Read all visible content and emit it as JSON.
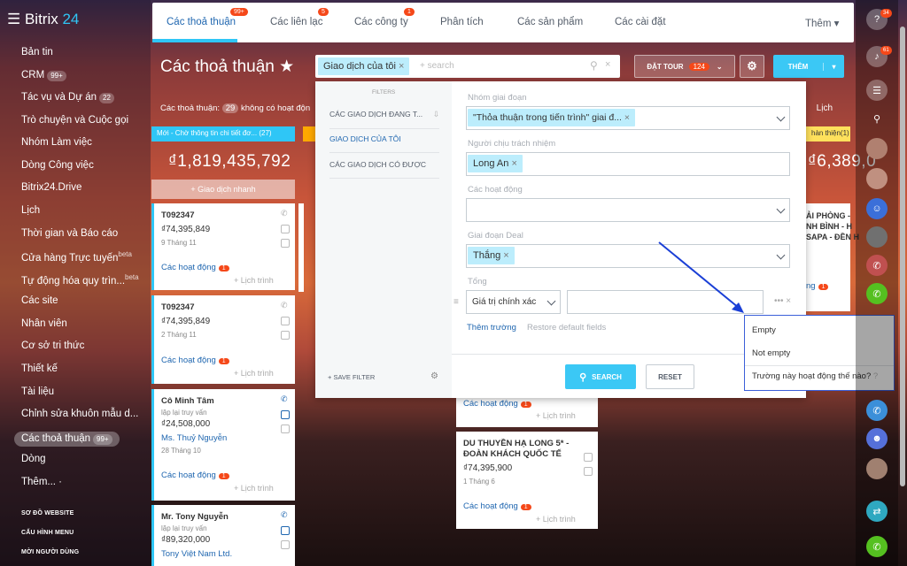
{
  "app": {
    "logo_a": "Bitrix",
    "logo_b": " 24"
  },
  "menu": [
    {
      "label": "Bản tin",
      "count": ""
    },
    {
      "label": "CRM",
      "count": "99+"
    },
    {
      "label": "Tác vụ và Dự án",
      "count": "22"
    },
    {
      "label": "Trò chuyện và Cuộc gọi",
      "count": ""
    },
    {
      "label": "Nhóm Làm việc",
      "count": ""
    },
    {
      "label": "Dòng Công việc",
      "count": ""
    },
    {
      "label": "Bitrix24.Drive",
      "count": ""
    },
    {
      "label": "Lịch",
      "count": ""
    },
    {
      "label": "Thời gian và Báo cáo",
      "count": ""
    },
    {
      "label": "Cửa hàng Trực tuyến",
      "count": "beta"
    },
    {
      "label": "Tự động hóa quy trìn...",
      "count": "beta"
    },
    {
      "label": "Các site",
      "count": ""
    },
    {
      "label": "Nhân viên",
      "count": ""
    },
    {
      "label": "Cơ sở tri thức",
      "count": ""
    },
    {
      "label": "Thiết kế",
      "count": ""
    },
    {
      "label": "Tài liệu",
      "count": ""
    },
    {
      "label": "Chỉnh sửa khuôn mẫu d...",
      "count": ""
    },
    {
      "label": "Các thoả thuận",
      "count": "99+"
    },
    {
      "label": "Dòng",
      "count": ""
    },
    {
      "label": "Thêm... ·",
      "count": ""
    }
  ],
  "menu_footer": [
    "SƠ ĐỒ WEBSITE",
    "CẤU HÌNH MENU",
    "MỜI NGƯỜI DÙNG"
  ],
  "tabs": [
    {
      "label": "Các thoả thuận",
      "badge": "99+"
    },
    {
      "label": "Các liên lạc",
      "badge": "5"
    },
    {
      "label": "Các công ty",
      "badge": "1"
    },
    {
      "label": "Phân tích",
      "badge": ""
    },
    {
      "label": "Các sản phẩm",
      "badge": ""
    },
    {
      "label": "Các cài đặt",
      "badge": ""
    },
    {
      "label": "Thêm ▾",
      "badge": ""
    }
  ],
  "page": {
    "title": "Các thoả thuận ★",
    "filter_chip": "Giao dịch của tôi",
    "search_placeholder": "+ search",
    "tour_label": "ĐẶT TOUR",
    "tour_count": "124",
    "add_label": "THÊM",
    "subtitle": "Các thoả thuận:",
    "sub_count": "29",
    "sub_text": "không có hoạt độn",
    "view_right": "ch    Lịch"
  },
  "columns": [
    {
      "title": "Mới - Chờ thông tin chi tiết đơ...",
      "count": "(27)",
      "amount": "₫1,819,435,792"
    },
    {
      "title": "hàn thiện",
      "count": "(1)",
      "amount": "₫6,389,0"
    }
  ],
  "quick_add": "+ Giao dịch nhanh",
  "cards": [
    {
      "title": "T092347",
      "sub": "",
      "value": "₫74,395,849",
      "link": "",
      "date": "9 Tháng 11",
      "act": "Các hoạt động",
      "badge": "1",
      "sched": "+ Lịch trình"
    },
    {
      "title": "T092347",
      "sub": "",
      "value": "₫74,395,849",
      "link": "",
      "date": "2 Tháng 11",
      "act": "Các hoạt động",
      "badge": "1",
      "sched": "+ Lịch trình"
    },
    {
      "title": "Cô Minh Tâm",
      "sub": "lặp lại truy vấn",
      "value": "₫24,508,000",
      "link": "Ms. Thuỷ Nguyễn",
      "date": "28 Tháng 10",
      "act": "Các hoạt động",
      "badge": "1",
      "sched": "+ Lịch trình"
    },
    {
      "title": "Mr. Tony Nguyễn",
      "sub": "lặp lại truy vấn",
      "value": "₫89,320,000",
      "link": "Tony Việt Nam Ltd.",
      "date": "",
      "act": "",
      "badge": "",
      "sched": ""
    }
  ],
  "mid_cards": [
    {
      "act": "Các hoạt động",
      "badge": "1",
      "sched": "+ Lịch trình"
    },
    {
      "title1": "DU THUYỀN HẠ LONG 5* -",
      "title2": "ĐOÀN KHÁCH QUỐC TẾ",
      "value": "₫74,395,900",
      "date": "1 Tháng 6",
      "act": "Các hoạt động",
      "badge": "1",
      "sched": "+ Lịch trình"
    }
  ],
  "right_card": {
    "l1": "ẢI PHÒNG -",
    "l2": "NH BÌNH - H",
    "l3": "SAPA - ĐỀN H",
    "act": "ng",
    "badge": "1"
  },
  "popup": {
    "filters_head": "FILTERS",
    "filters": [
      "CÁC GIAO DỊCH ĐANG T...",
      "GIAO DỊCH CỦA TÔI",
      "CÁC GIAO DỊCH CÓ ĐƯỢC"
    ],
    "save_filter": "+ SAVE FILTER",
    "f1_label": "Nhóm giai đoạn",
    "f1_value": "\"Thỏa thuận trong tiến trình\" giai đ...",
    "f2_label": "Người chịu trách nhiệm",
    "f2_value": "Long An",
    "f3_label": "Các hoạt động",
    "f4_label": "Giai đoạn Deal",
    "f4_value": "Thắng",
    "f5_label": "Tổng",
    "f5_select": "Giá trị chính xác",
    "add_field": "Thêm trường",
    "restore": "Restore default fields",
    "search_btn": "SEARCH",
    "reset_btn": "RESET"
  },
  "dropdown": [
    "Empty",
    "Not empty",
    "Trường này hoạt động thế nào?"
  ],
  "rightbar_badges": [
    "34",
    "61"
  ]
}
